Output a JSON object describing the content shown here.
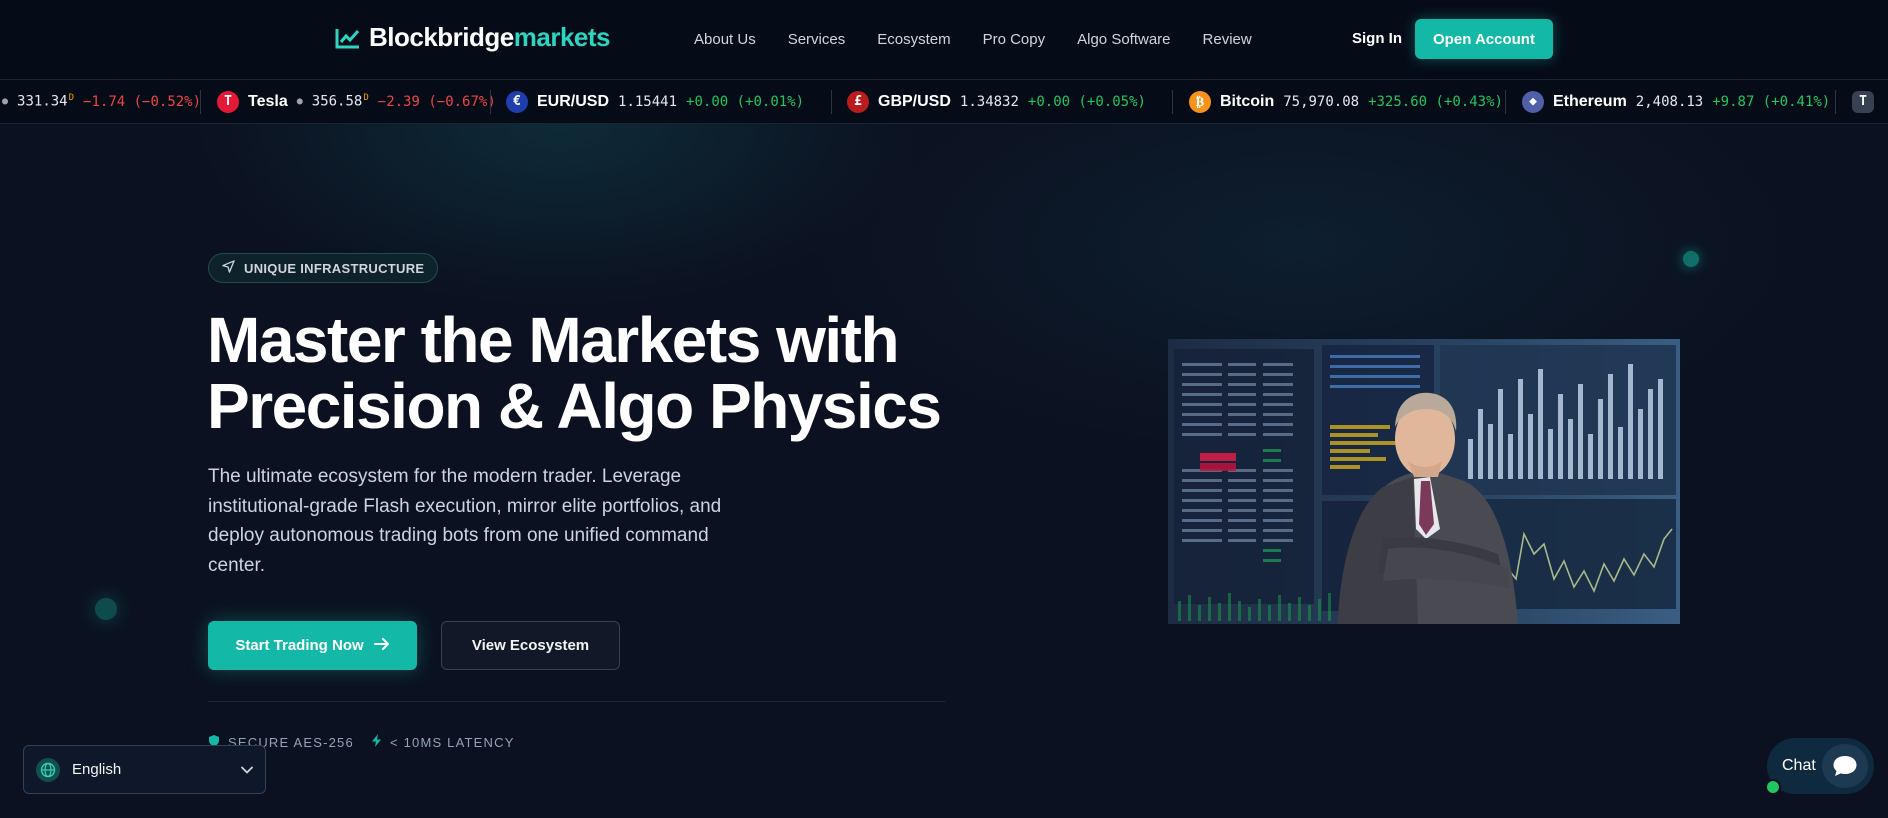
{
  "brand": {
    "name_main": "Blockbridge",
    "name_accent": "markets",
    "accent_color": "#2dd4bf"
  },
  "nav": {
    "links": [
      "About Us",
      "Services",
      "Ecosystem",
      "Pro Copy",
      "Algo Software",
      "Review"
    ],
    "sign_in": "Sign In",
    "open_account": "Open Account"
  },
  "ticker": [
    {
      "name": "",
      "price": "331.34",
      "sup": "D",
      "change": "−1.74 (−0.52%)",
      "dir": "down",
      "icon": ""
    },
    {
      "name": "Tesla",
      "price": "356.58",
      "sup": "D",
      "change": "−2.39 (−0.67%)",
      "dir": "down",
      "icon": "tesla-icon"
    },
    {
      "name": "EUR/USD",
      "price": "1.15441",
      "sup": "",
      "change": "+0.00 (+0.01%)",
      "dir": "up",
      "icon": "eu-us-flag-icon"
    },
    {
      "name": "GBP/USD",
      "price": "1.34832",
      "sup": "",
      "change": "+0.00 (+0.05%)",
      "dir": "up",
      "icon": "uk-us-flag-icon"
    },
    {
      "name": "Bitcoin",
      "price": "75,970.08",
      "sup": "",
      "change": "+325.60 (+0.43%)",
      "dir": "up",
      "icon": "bitcoin-icon"
    },
    {
      "name": "Ethereum",
      "price": "2,408.13",
      "sup": "",
      "change": "+9.87 (+0.41%)",
      "dir": "up",
      "icon": "ethereum-icon"
    }
  ],
  "hero": {
    "badge": "UNIQUE INFRASTRUCTURE",
    "headline_line1": "Master the Markets with",
    "headline_line2": "Precision & Algo Physics",
    "subtext": "The ultimate ecosystem for the modern trader. Leverage institutional-grade Flash execution, mirror elite portfolios, and deploy autonomous trading bots from one unified command center.",
    "cta_primary": "Start Trading Now",
    "cta_secondary": "View Ecosystem",
    "features": [
      "SECURE AES-256",
      "< 10MS LATENCY"
    ]
  },
  "language": {
    "selected": "English"
  },
  "chat": {
    "label": "Chat"
  }
}
